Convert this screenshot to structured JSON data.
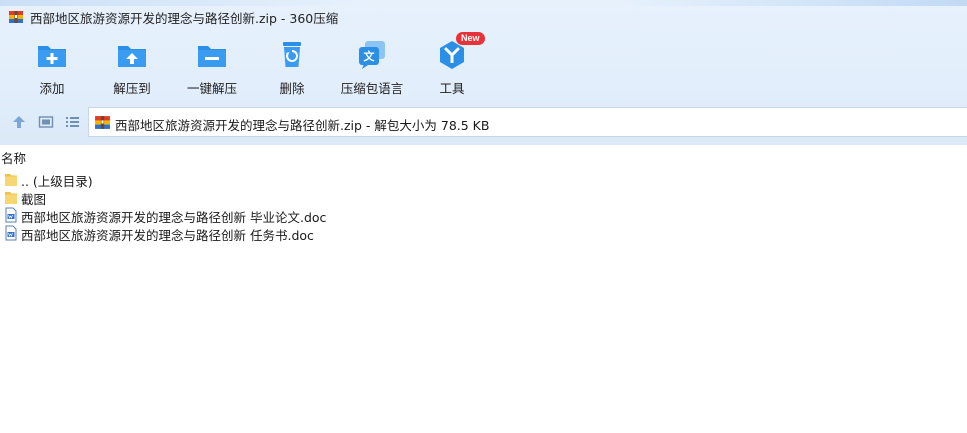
{
  "window": {
    "title": "西部地区旅游资源开发的理念与路径创新.zip - 360压缩"
  },
  "toolbar": {
    "items": [
      {
        "label": "添加",
        "icon": "add-folder-icon"
      },
      {
        "label": "解压到",
        "icon": "extract-to-icon"
      },
      {
        "label": "一键解压",
        "icon": "one-click-extract-icon"
      },
      {
        "label": "删除",
        "icon": "recycle-bin-icon"
      },
      {
        "label": "压缩包语言",
        "icon": "language-icon"
      },
      {
        "label": "工具",
        "icon": "tools-icon",
        "badge": "New"
      }
    ]
  },
  "address": {
    "text": "西部地区旅游资源开发的理念与路径创新.zip - 解包大小为 78.5 KB"
  },
  "list": {
    "column_name": "名称",
    "items": [
      {
        "name": ".. (上级目录)",
        "type": "folder"
      },
      {
        "name": "截图",
        "type": "folder"
      },
      {
        "name": "西部地区旅游资源开发的理念与路径创新 毕业论文.doc",
        "type": "doc"
      },
      {
        "name": "西部地区旅游资源开发的理念与路径创新 任务书.doc",
        "type": "doc"
      }
    ]
  },
  "colors": {
    "accent_blue": "#2b8fe6",
    "chrome_bg": "#e2eefb",
    "badge_red": "#e8323a"
  }
}
